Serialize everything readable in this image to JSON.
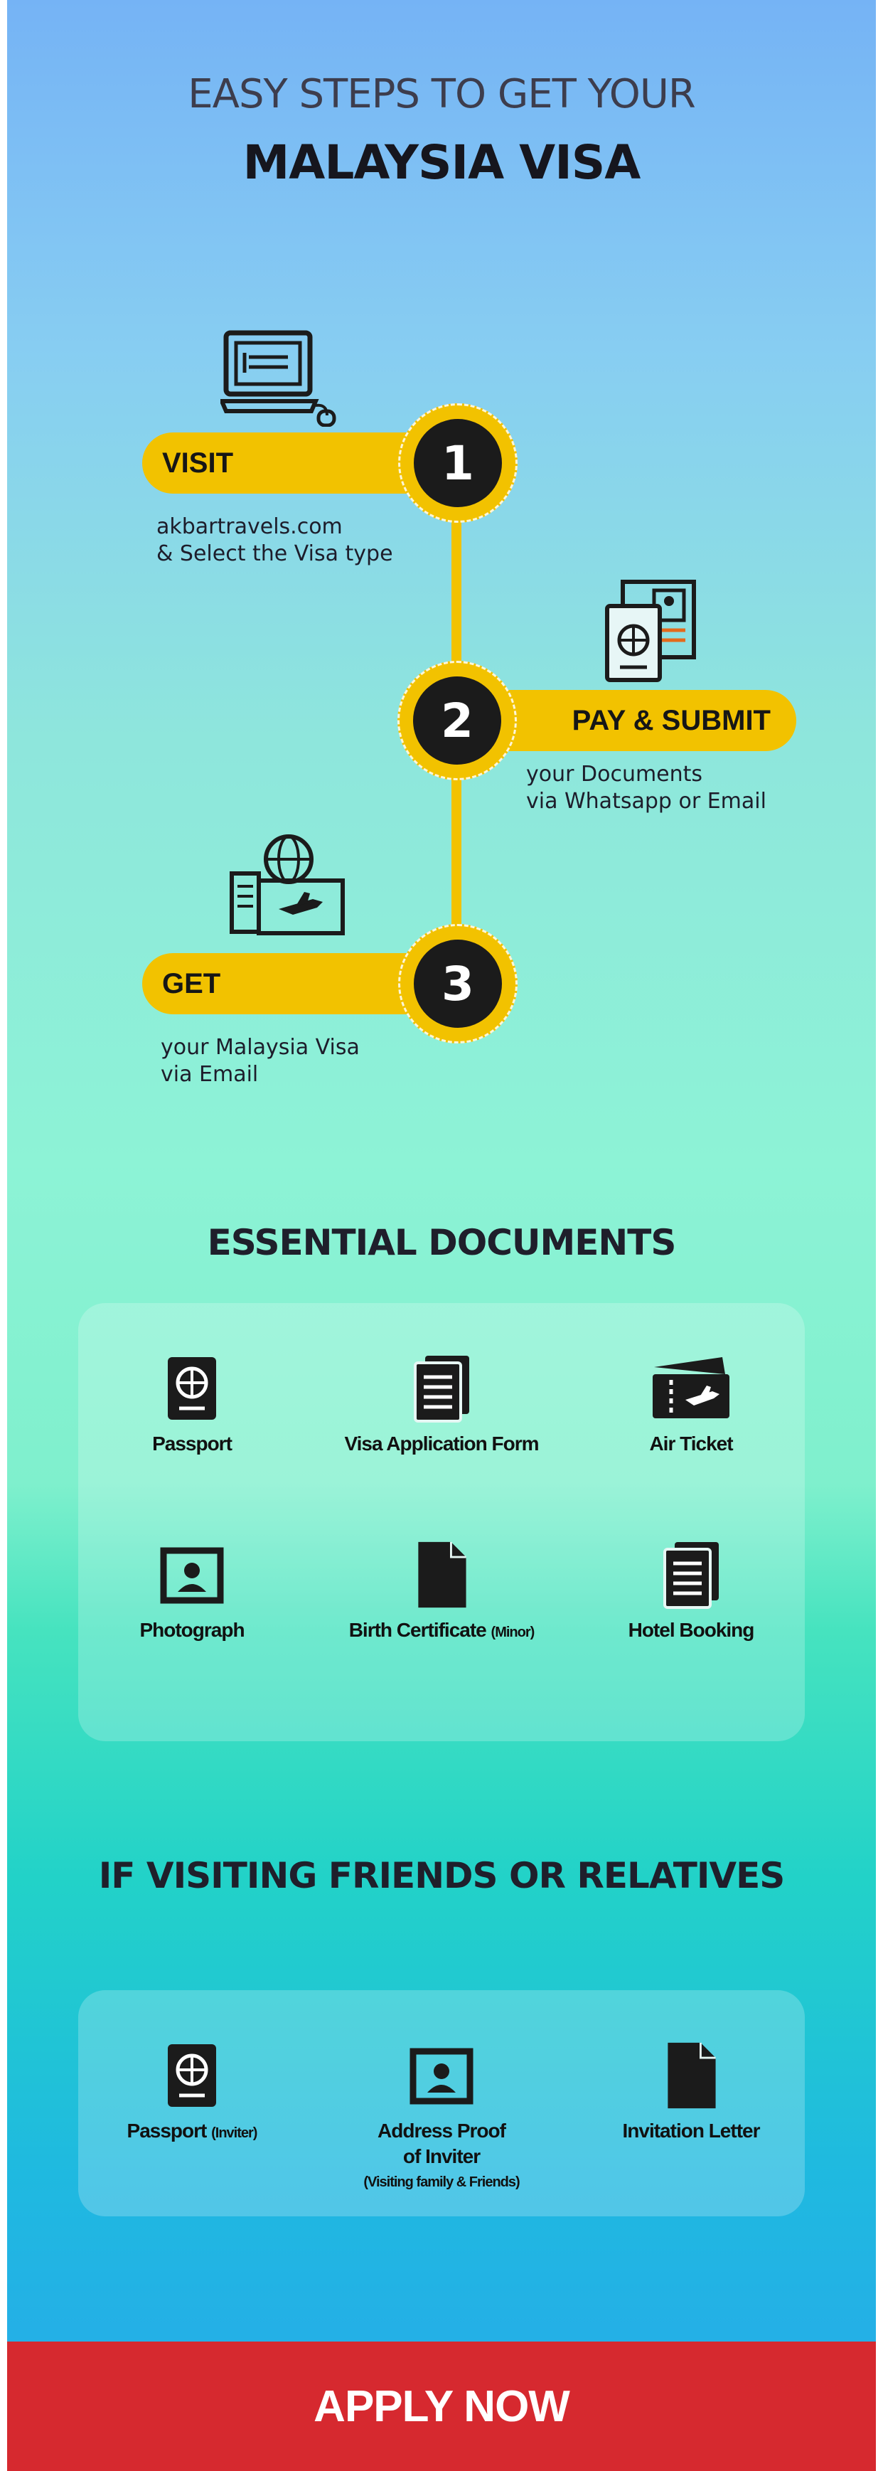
{
  "header": {
    "line1": "EASY STEPS TO GET YOUR",
    "line2": "MALAYSIA VISA"
  },
  "steps": [
    {
      "number": "1",
      "label": "VISIT",
      "line1": "akbartravels.com",
      "line2": "& Select the Visa type",
      "icon": "computer-icon"
    },
    {
      "number": "2",
      "label": "PAY & SUBMIT",
      "line1": "your Documents",
      "line2": "via Whatsapp or Email",
      "icon": "documents-icon"
    },
    {
      "number": "3",
      "label": "GET",
      "line1": "your Malaysia Visa",
      "line2": "via Email",
      "icon": "visa-icon"
    }
  ],
  "essential": {
    "title": "ESSENTIAL DOCUMENTS",
    "items": [
      {
        "label": "Passport",
        "icon": "passport-icon"
      },
      {
        "label": "Visa Application Form",
        "icon": "form-icon"
      },
      {
        "label": "Air Ticket",
        "icon": "ticket-icon"
      },
      {
        "label": "Photograph",
        "icon": "photo-icon"
      },
      {
        "label": "Birth Certificate",
        "suffix": "(Minor)",
        "icon": "file-icon"
      },
      {
        "label": "Hotel Booking",
        "icon": "booking-icon"
      }
    ]
  },
  "visiting": {
    "title": "IF VISITING FRIENDS OR RELATIVES",
    "items": [
      {
        "label": "Passport",
        "suffix": "(Inviter)",
        "icon": "passport-icon"
      },
      {
        "label": "Address Proof",
        "label2": "of Inviter",
        "suffix": "(Visiting family & Friends)",
        "icon": "id-card-icon"
      },
      {
        "label": "Invitation Letter",
        "icon": "letter-icon"
      }
    ]
  },
  "cta": {
    "label": "APPLY NOW"
  },
  "colors": {
    "accent": "#f2c200",
    "cta": "#d6292f",
    "dark": "#1b1b1b"
  }
}
